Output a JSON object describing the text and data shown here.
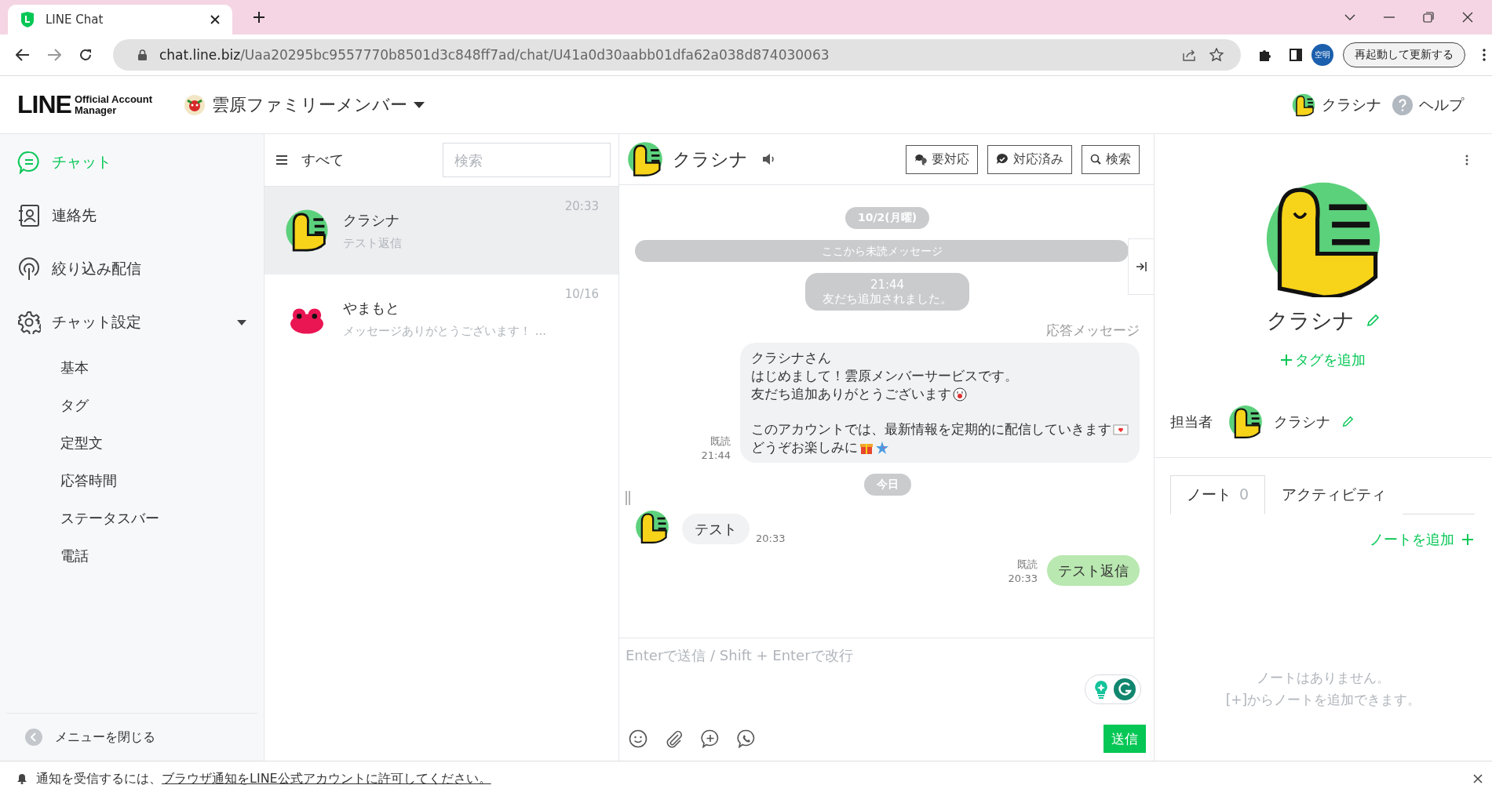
{
  "browser": {
    "tab_title": "LINE Chat",
    "url_host": "chat.line.biz",
    "url_path": "/Uaa20295bc9557770b8501d3c848ff7ad/chat/U41a0d30aabb01dfa62a038d874030063",
    "profile": "空明",
    "update_button": "再起動して更新する"
  },
  "header": {
    "logo": "LINE",
    "logo_sub": [
      "Official Account",
      "Manager"
    ],
    "account_name": "雲原ファミリーメンバー",
    "user_name": "クラシナ",
    "help": "ヘルプ"
  },
  "sidebar": {
    "items": [
      {
        "label": "チャット",
        "selected": true
      },
      {
        "label": "連絡先",
        "selected": false
      },
      {
        "label": "絞り込み配信",
        "selected": false
      },
      {
        "label": "チャット設定",
        "selected": false,
        "expanded": true,
        "children": [
          {
            "label": "基本"
          },
          {
            "label": "タグ"
          },
          {
            "label": "定型文"
          },
          {
            "label": "応答時間"
          },
          {
            "label": "ステータスバー"
          },
          {
            "label": "電話"
          }
        ]
      }
    ],
    "close_menu": "メニューを閉じる"
  },
  "chat_list": {
    "filter": "すべて",
    "search": {
      "placeholder": "検索"
    },
    "conversations": [
      {
        "name": "クラシナ",
        "preview": "テスト返信",
        "time": "20:33",
        "selected": true
      },
      {
        "name": "やまもと",
        "preview": "メッセージありがとうございます！ ...",
        "time": "10/16",
        "selected": false
      }
    ]
  },
  "chat": {
    "contact_name": "クラシナ",
    "buttons": [
      "要対応",
      "対応済み",
      "検索"
    ],
    "messages": [
      {
        "kind": "date",
        "text": "10/2(月曜)"
      },
      {
        "kind": "unread",
        "text": "ここから未読メッセージ"
      },
      {
        "kind": "system",
        "lines": [
          "21:44",
          "友だち追加されました。"
        ]
      },
      {
        "kind": "outgoing",
        "label": "応答メッセージ",
        "paragraphs": [
          [
            "クラシナさん",
            "はじめまして！雲原メンバーサービスです。",
            "友だち追加ありがとうございます"
          ],
          [
            "このアカウントでは、最新情報を定期的に配信していきます",
            "どうぞお楽しみに"
          ]
        ],
        "read": "既読",
        "time": "21:44"
      },
      {
        "kind": "date",
        "text": "今日"
      },
      {
        "kind": "incoming",
        "lines": [
          "テスト"
        ],
        "time": "20:33"
      },
      {
        "kind": "outgoing",
        "paragraphs": [
          [
            "テスト返信"
          ]
        ],
        "read": "既読",
        "time": "20:33",
        "green": true
      }
    ],
    "composer": {
      "placeholder": "Enterで送信 / Shift + Enterで改行"
    },
    "send": "送信"
  },
  "profile": {
    "name": "クラシナ",
    "add_tag": "タグを追加",
    "assignee_label": "担当者",
    "assignee_name": "クラシナ",
    "tabs": [
      {
        "label": "ノート",
        "count": "0",
        "selected": true
      },
      {
        "label": "アクティビティ",
        "selected": false
      }
    ],
    "add_note": "ノートを追加",
    "empty": [
      "ノートはありません。",
      "[+]からノートを追加できます。"
    ]
  },
  "notice": {
    "text": "通知を受信するには、",
    "link": "ブラウザ通知をLINE公式アカウントに許可してください。"
  }
}
